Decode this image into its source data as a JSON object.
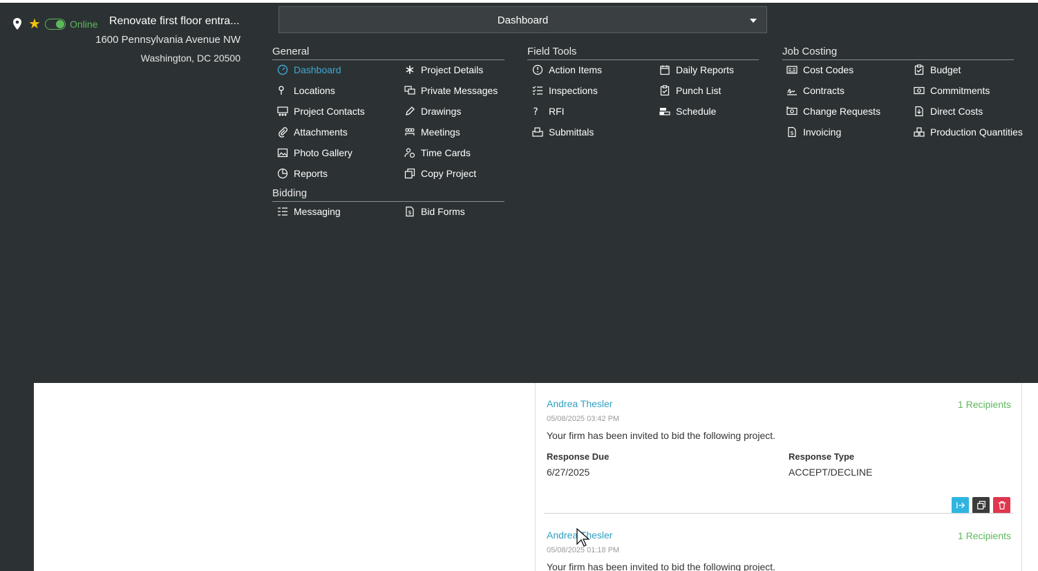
{
  "project": {
    "status": "Online",
    "title": "Renovate first floor entra...",
    "address_line1": "1600 Pennsylvania Avenue NW",
    "address_line2": "Washington, DC 20500"
  },
  "nav": {
    "selected": "Dashboard"
  },
  "menu": {
    "general": {
      "heading": "General",
      "items": [
        "Dashboard",
        "Project Details",
        "Locations",
        "Private Messages",
        "Project Contacts",
        "Drawings",
        "Attachments",
        "Meetings",
        "Photo Gallery",
        "Time Cards",
        "Reports",
        "Copy Project"
      ]
    },
    "bidding": {
      "heading": "Bidding",
      "items": [
        "Messaging",
        "Bid Forms"
      ]
    },
    "field_tools": {
      "heading": "Field Tools",
      "items": [
        "Action Items",
        "Daily Reports",
        "Inspections",
        "Punch List",
        "RFI",
        "Schedule",
        "Submittals"
      ]
    },
    "job_costing": {
      "heading": "Job Costing",
      "items": [
        "Cost Codes",
        "Budget",
        "Contracts",
        "Commitments",
        "Change Requests",
        "Direct Costs",
        "Invoicing",
        "Production Quantities"
      ]
    }
  },
  "messages": [
    {
      "author": "Andrea Thesler",
      "recipients": "1 Recipients",
      "datetime": "05/08/2025 03:42 PM",
      "body": "Your firm has been invited to bid the following project.",
      "response_due_label": "Response Due",
      "response_due": "6/27/2025",
      "response_type_label": "Response Type",
      "response_type": "ACCEPT/DECLINE"
    },
    {
      "author": "Andrea Thesler",
      "recipients": "1 Recipients",
      "datetime": "05/08/2025 01:18 PM",
      "body": "Your firm has been invited to bid the following project."
    }
  ],
  "colors": {
    "panel": "#2c3233",
    "accent_blue": "#3fa9d6",
    "online_green": "#5cb85c",
    "forward_button": "#2fb5e0",
    "copy_button": "#3b3b3b",
    "delete_button": "#e0364e"
  }
}
